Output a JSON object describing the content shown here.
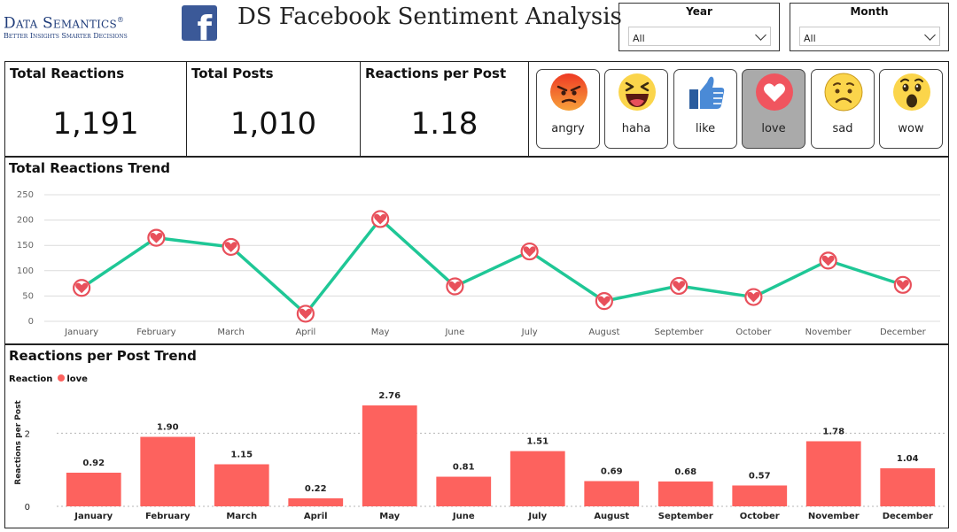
{
  "header": {
    "brand_name": "Data Semantics",
    "brand_mark": "®",
    "brand_tagline": "Better Insights Smarter Decisions",
    "logo_letter": "f",
    "title": "DS Facebook Sentiment Analysis"
  },
  "filters": {
    "year": {
      "label": "Year",
      "value": "All"
    },
    "month": {
      "label": "Month",
      "value": "All"
    }
  },
  "kpis": [
    {
      "label": "Total Reactions",
      "value": "1,191"
    },
    {
      "label": "Total Posts",
      "value": "1,010"
    },
    {
      "label": "Reactions per Post",
      "value": "1.18"
    }
  ],
  "reactions": [
    {
      "label": "angry",
      "icon": "angry-emoji-icon",
      "selected": false
    },
    {
      "label": "haha",
      "icon": "haha-emoji-icon",
      "selected": false
    },
    {
      "label": "like",
      "icon": "thumbs-up-icon",
      "selected": false
    },
    {
      "label": "love",
      "icon": "heart-icon",
      "selected": true
    },
    {
      "label": "sad",
      "icon": "sad-emoji-icon",
      "selected": false
    },
    {
      "label": "wow",
      "icon": "wow-emoji-icon",
      "selected": false
    }
  ],
  "colors": {
    "line": "#1fc796",
    "marker": "#e8505b",
    "bar": "#fd625e",
    "selected_button": "#aaaaaa",
    "fb_blue": "#3b5998",
    "brand_navy": "#1f3c7a"
  },
  "chart_data": [
    {
      "type": "line",
      "title": "Total Reactions Trend",
      "categories": [
        "January",
        "February",
        "March",
        "April",
        "May",
        "June",
        "July",
        "August",
        "September",
        "October",
        "November",
        "December"
      ],
      "series": [
        {
          "values": [
            66,
            165,
            147,
            15,
            202,
            69,
            138,
            40,
            70,
            48,
            120,
            72
          ]
        }
      ],
      "y_ticks": [
        "0",
        "50",
        "100",
        "150",
        "200",
        "250"
      ],
      "ylim": [
        0,
        250
      ],
      "grid": true,
      "marker": "heart"
    },
    {
      "type": "bar",
      "title": "Reactions per Post Trend",
      "legend_title": "Reaction",
      "categories": [
        "January",
        "February",
        "March",
        "April",
        "May",
        "June",
        "July",
        "August",
        "September",
        "October",
        "November",
        "December"
      ],
      "series": [
        {
          "name": "love",
          "values": [
            0.92,
            1.9,
            1.15,
            0.22,
            2.76,
            0.81,
            1.51,
            0.69,
            0.68,
            0.57,
            1.78,
            1.04
          ]
        }
      ],
      "value_labels": [
        "0.92",
        "1.90",
        "1.15",
        "0.22",
        "2.76",
        "0.81",
        "1.51",
        "0.69",
        "0.68",
        "0.57",
        "1.78",
        "1.04"
      ],
      "ylabel": "Reactions per Post",
      "y_ticks": [
        "0",
        "2"
      ],
      "ylim": [
        0,
        2.76
      ],
      "legend_position": "top-left",
      "grid": true
    }
  ]
}
